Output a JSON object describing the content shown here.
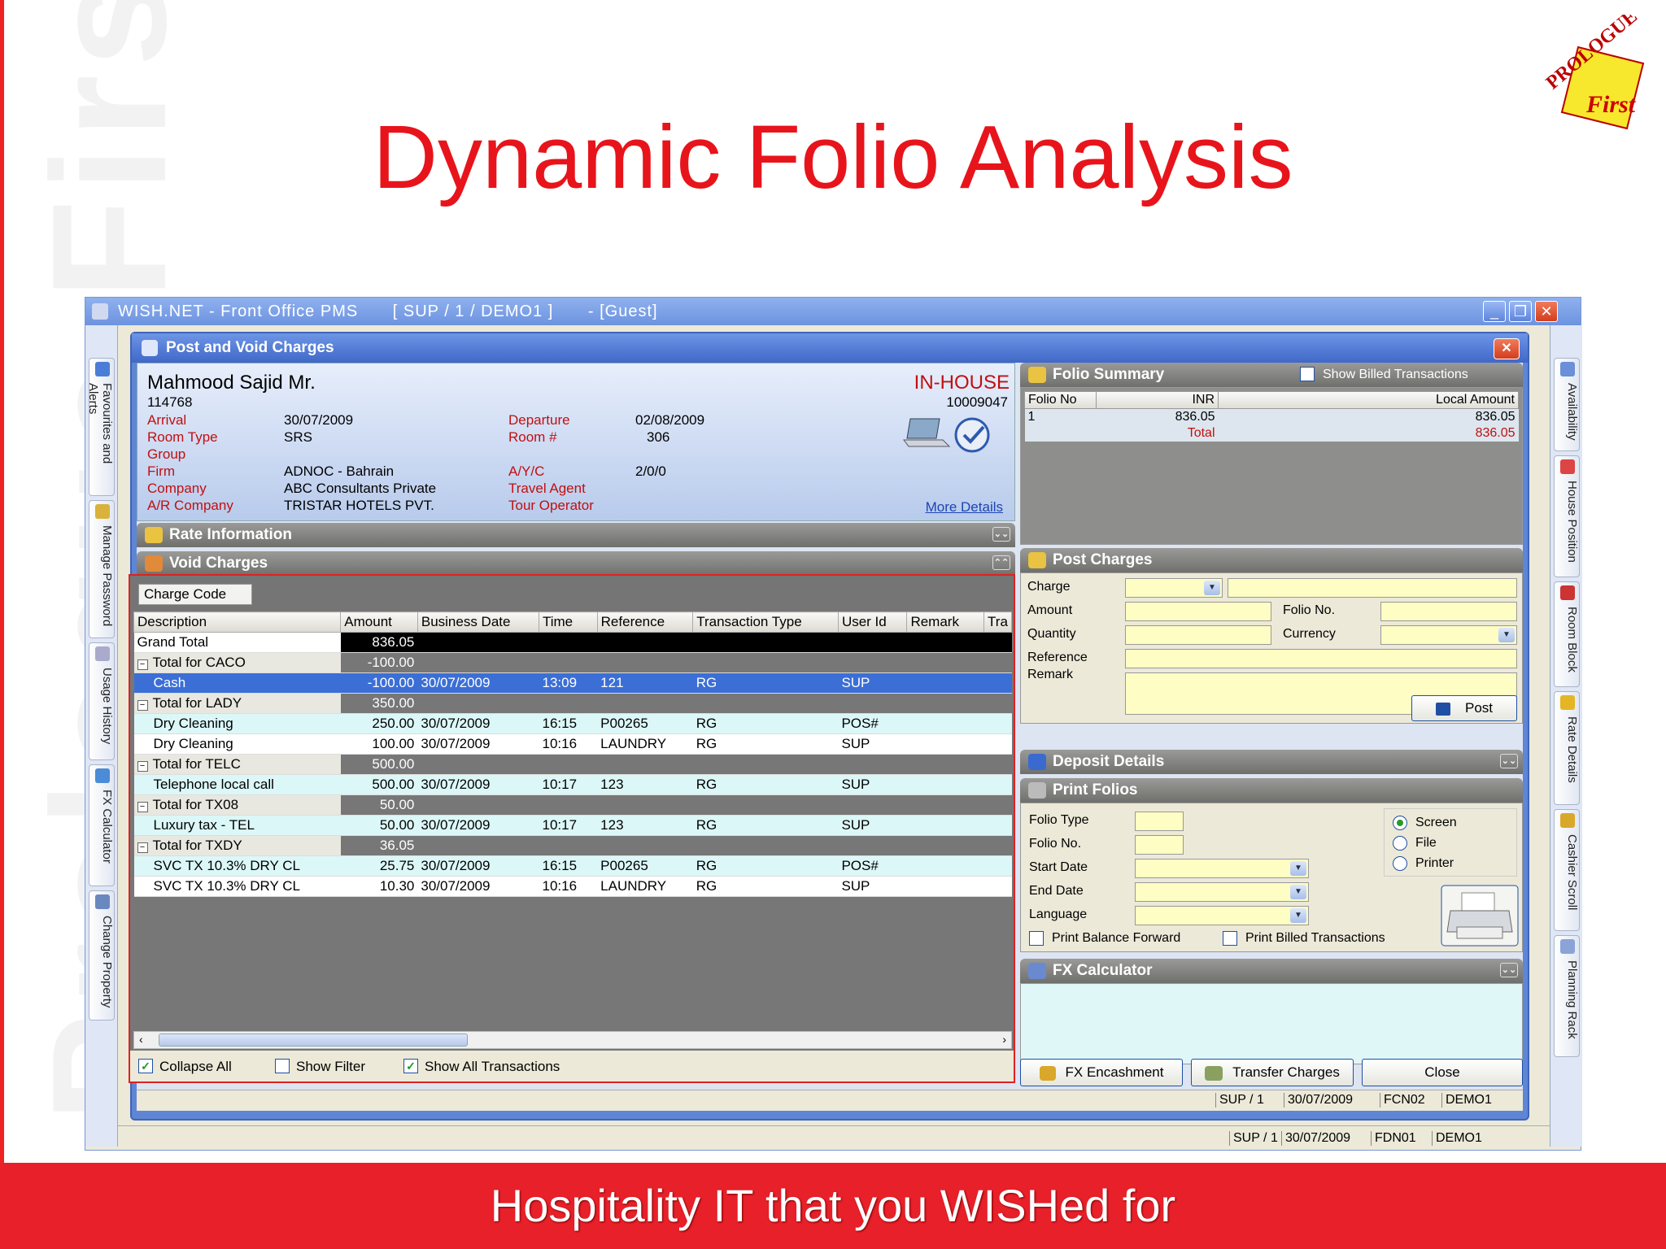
{
  "slide": {
    "watermark": "Prologue First",
    "title": "Dynamic Folio Analysis",
    "logo_text_top": "PROLOGUE",
    "logo_text_bottom": "First",
    "footer": "Hospitality IT that you WISHed for"
  },
  "app": {
    "title": "WISH.NET - Front Office PMS",
    "context": "[ SUP / 1 / DEMO1 ]",
    "guest_tag": "- [Guest]",
    "left_tabs": [
      "Favourites and Alerts",
      "Manage Password",
      "Usage History",
      "FX Calculator",
      "Change Property"
    ],
    "right_tabs": [
      "Availability",
      "House Position",
      "Room Block",
      "Rate Details",
      "Cashier Scroll",
      "Planning Rack"
    ],
    "status": [
      "SUP / 1",
      "30/07/2009",
      "FDN01",
      "DEMO1"
    ]
  },
  "dialog": {
    "title": "Post and Void Charges",
    "status": [
      "SUP / 1",
      "30/07/2009",
      "FCN02",
      "DEMO1"
    ],
    "guest": {
      "name": "Mahmood Sajid Mr.",
      "id": "114768",
      "state": "IN-HOUSE",
      "reservation_no": "10009047",
      "arrival_label": "Arrival",
      "arrival": "30/07/2009",
      "room_type_label": "Room Type",
      "room_type": "SRS",
      "group_label": "Group",
      "group": "",
      "firm_label": "Firm",
      "firm": "ADNOC - Bahrain",
      "company_label": "Company",
      "company": "ABC Consultants Private",
      "ar_label": "A/R Company",
      "ar_company": "TRISTAR HOTELS PVT.",
      "departure_label": "Departure",
      "departure": "02/08/2009",
      "room_label": "Room #",
      "room": "306",
      "ayc_label": "A/Y/C",
      "ayc": "2/0/0",
      "travel_agent_label": "Travel Agent",
      "tour_operator_label": "Tour Operator",
      "more_details": "More Details"
    },
    "rate_bar": "Rate Information",
    "void_bar": "Void Charges",
    "grid": {
      "charge_code": "Charge Code",
      "columns": [
        "Description",
        "Amount",
        "Business Date",
        "Time",
        "Reference",
        "Transaction Type",
        "User Id",
        "Remark",
        "Tra"
      ],
      "grand_total_label": "Grand Total",
      "grand_total": "836.05",
      "groups": [
        {
          "label": "Total for CACO",
          "amount": "-100.00",
          "rows": [
            {
              "desc": "Cash",
              "amount": "-100.00",
              "date": "30/07/2009",
              "time": "13:09",
              "ref": "121",
              "type": "RG",
              "user": "SUP",
              "selected": true
            }
          ]
        },
        {
          "label": "Total for LADY",
          "amount": "350.00",
          "rows": [
            {
              "desc": "Dry Cleaning",
              "amount": "250.00",
              "date": "30/07/2009",
              "time": "16:15",
              "ref": "P00265",
              "type": "RG",
              "user": "POS#"
            },
            {
              "desc": "Dry Cleaning",
              "amount": "100.00",
              "date": "30/07/2009",
              "time": "10:16",
              "ref": "LAUNDRY",
              "type": "RG",
              "user": "SUP"
            }
          ]
        },
        {
          "label": "Total for TELC",
          "amount": "500.00",
          "rows": [
            {
              "desc": "Telephone local call",
              "amount": "500.00",
              "date": "30/07/2009",
              "time": "10:17",
              "ref": "123",
              "type": "RG",
              "user": "SUP"
            }
          ]
        },
        {
          "label": "Total for TX08",
          "amount": "50.00",
          "rows": [
            {
              "desc": "Luxury tax - TEL",
              "amount": "50.00",
              "date": "30/07/2009",
              "time": "10:17",
              "ref": "123",
              "type": "RG",
              "user": "SUP"
            }
          ]
        },
        {
          "label": "Total for TXDY",
          "amount": "36.05",
          "rows": [
            {
              "desc": "SVC TX 10.3% DRY CL",
              "amount": "25.75",
              "date": "30/07/2009",
              "time": "16:15",
              "ref": "P00265",
              "type": "RG",
              "user": "POS#"
            },
            {
              "desc": "SVC TX 10.3% DRY CL",
              "amount": "10.30",
              "date": "30/07/2009",
              "time": "10:16",
              "ref": "LAUNDRY",
              "type": "RG",
              "user": "SUP"
            }
          ]
        }
      ],
      "collapse_all": "Collapse All",
      "show_filter": "Show Filter",
      "show_all": "Show All Transactions"
    },
    "folio_summary": {
      "title": "Folio Summary",
      "show_billed": "Show Billed Transactions",
      "columns": [
        "Folio No",
        "INR",
        "Local Amount"
      ],
      "rows": [
        {
          "folio": "1",
          "inr": "836.05",
          "local": "836.05"
        }
      ],
      "total_label": "Total",
      "total": "836.05"
    },
    "post_charges": {
      "title": "Post Charges",
      "charge": "Charge",
      "amount": "Amount",
      "folio_no": "Folio No.",
      "quantity": "Quantity",
      "currency": "Currency",
      "reference": "Reference",
      "remark": "Remark",
      "post": "Post"
    },
    "deposit_bar": "Deposit Details",
    "print_folios": {
      "title": "Print Folios",
      "folio_type": "Folio Type",
      "folio_no": "Folio No.",
      "start_date": "Start Date",
      "end_date": "End Date",
      "language": "Language",
      "screen": "Screen",
      "file": "File",
      "printer": "Printer",
      "balance_forward": "Print Balance Forward",
      "billed": "Print Billed Transactions"
    },
    "fx_bar": "FX Calculator",
    "buttons": {
      "fx": "FX Encashment",
      "transfer": "Transfer Charges",
      "close": "Close"
    }
  }
}
